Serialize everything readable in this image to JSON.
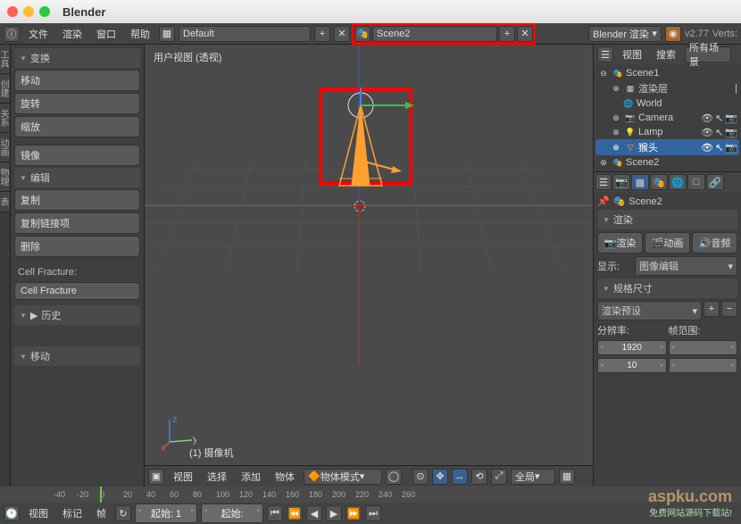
{
  "title": "Blender",
  "header": {
    "menus": [
      "文件",
      "渲染",
      "窗口",
      "帮助"
    ],
    "layout_selector": "Default",
    "scene_selector": "Scene2",
    "engine": "Blender 渲染",
    "version": "v2.77",
    "stats": "Verts:"
  },
  "left_tabs": [
    "工具",
    "创建",
    "关系",
    "动画",
    "物理",
    "表"
  ],
  "tool_panel": {
    "transform_header": "变换",
    "transform_buttons": [
      "移动",
      "旋转",
      "缩放"
    ],
    "mirror": "镜像",
    "edit_header": "编辑",
    "edit_buttons": [
      "复制",
      "复制链接项",
      "删除"
    ],
    "cell_label": "Cell Fracture:",
    "cell_button": "Cell Fracture",
    "history_header": "历史",
    "move_header": "移动"
  },
  "viewport": {
    "label": "用户视图 (透视)",
    "camera_label": "(1) 摄像机",
    "axes": {
      "x": "x",
      "y": "y",
      "z": "z"
    },
    "menus": [
      "视图",
      "选择",
      "添加",
      "物体"
    ],
    "mode": "物体模式",
    "orientation": "全局"
  },
  "outliner": {
    "menus": [
      "视图",
      "搜索"
    ],
    "filter": "所有场景",
    "tree": [
      {
        "label": "Scene1",
        "icon": "scene",
        "expanded": true,
        "children": [
          {
            "label": "渲染层",
            "icon": "renderlayer",
            "lock": true
          },
          {
            "label": "World",
            "icon": "world"
          },
          {
            "label": "Camera",
            "icon": "camera",
            "vis": true
          },
          {
            "label": "Lamp",
            "icon": "lamp",
            "vis": true
          },
          {
            "label": "猴头",
            "icon": "mesh",
            "vis": true,
            "selected": true
          }
        ]
      },
      {
        "label": "Scene2",
        "icon": "scene",
        "expanded": false
      }
    ]
  },
  "properties": {
    "breadcrumb": "Scene2",
    "render_header": "渲染",
    "render_buttons": [
      "渲染",
      "动画",
      "音频"
    ],
    "display_label": "显示:",
    "display_value": "图像编辑",
    "dimensions_header": "规格尺寸",
    "preset": "渲染预设",
    "resolution_label": "分辨率:",
    "framerange_label": "帧范围:",
    "res_x": "1920",
    "res_y": "10"
  },
  "timeline": {
    "menus": [
      "视图",
      "标记",
      "帧"
    ],
    "start_label": "起始:",
    "start_value": "1",
    "end_label": "起始:",
    "ticks": [
      -40,
      -20,
      0,
      20,
      40,
      60,
      80,
      100,
      120,
      140,
      160,
      180,
      200,
      220,
      240,
      260
    ],
    "current": 0
  },
  "watermark": "aspku.com",
  "watermark2": "免费网站源码下载站!"
}
